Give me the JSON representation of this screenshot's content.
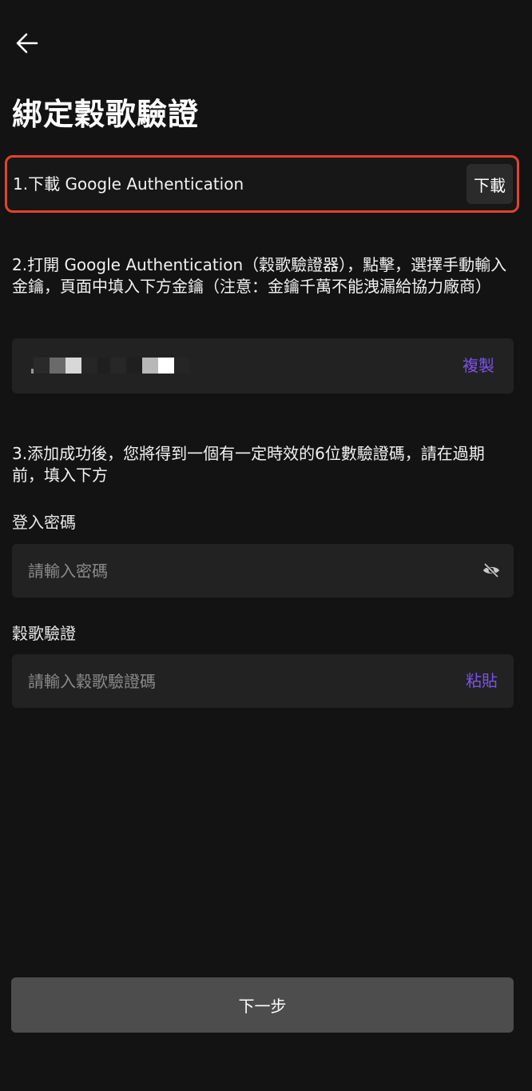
{
  "header": {
    "back_icon": "arrow-left-icon",
    "title": "綁定穀歌驗證"
  },
  "step1": {
    "text": "1.下載 Google Authentication",
    "download_label": "下載"
  },
  "step2": {
    "text": "2.打開 Google Authentication（穀歌驗證器），點擊，選擇手動輸入金鑰，頁面中填入下方金鑰（注意：金鑰千萬不能洩漏給協力廠商）",
    "copy_label": "複製"
  },
  "step3": {
    "text": "3.添加成功後，您將得到一個有一定時效的6位數驗證碼，請在過期前，填入下方"
  },
  "password_field": {
    "label": "登入密碼",
    "placeholder": "請輸入密碼",
    "toggle_icon": "eye-hidden-icon"
  },
  "google_code_field": {
    "label": "穀歌驗證",
    "placeholder": "請輸入穀歌驗證碼",
    "paste_label": "粘貼"
  },
  "footer": {
    "next_label": "下一步"
  },
  "colors": {
    "background": "#131313",
    "accent": "#7b52e8",
    "highlight_border": "#e2432c",
    "input_bg": "#222222",
    "button_bg": "#4d4d4d"
  }
}
